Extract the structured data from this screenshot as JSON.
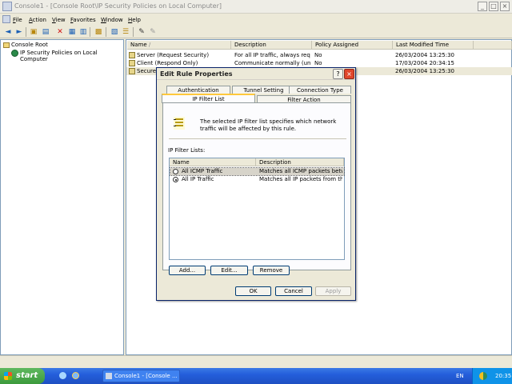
{
  "window": {
    "title": "Console1 - [Console Root\\IP Security Policies on Local Computer]"
  },
  "menu": [
    "File",
    "Action",
    "View",
    "Favorites",
    "Window",
    "Help"
  ],
  "toolbar_icons": [
    "back-icon",
    "forward-icon",
    "up-folder-icon",
    "show-hide-tree-icon",
    "delete-icon",
    "properties-icon",
    "refresh-icon",
    "export-icon",
    "help-icon",
    "manage-filters-icon",
    "assign-icon",
    "unassign-icon",
    "add-policy-icon"
  ],
  "tree": {
    "root": "Console Root",
    "child": "IP Security Policies on Local Computer"
  },
  "list": {
    "columns": [
      "Name",
      "Description",
      "Policy Assigned",
      "Last Modified Time"
    ],
    "rows": [
      {
        "name": "Server (Request Security)",
        "description": "For all IP traffic, always req...",
        "assigned": "No",
        "modified": "26/03/2004 13:25:30"
      },
      {
        "name": "Client (Respond Only)",
        "description": "Communicate normally (uns...",
        "assigned": "No",
        "modified": "17/03/2004 20:34:15"
      },
      {
        "name": "Secure S",
        "description": "",
        "assigned": "",
        "modified": "26/03/2004 13:25:30"
      }
    ]
  },
  "dialog": {
    "title": "Edit Rule Properties",
    "tabs_top": [
      "Authentication Methods",
      "Tunnel Setting",
      "Connection Type"
    ],
    "tabs_bottom": [
      "IP Filter List",
      "Filter Action"
    ],
    "info_text": "The selected IP filter list specifies which network traffic will be affected by this rule.",
    "filter_lists_label": "IP Filter Lists:",
    "filter_columns": [
      "Name",
      "Description"
    ],
    "filters": [
      {
        "name": "All ICMP Traffic",
        "description": "Matches all ICMP packets betw...",
        "selected": false
      },
      {
        "name": "All IP Traffic",
        "description": "Matches all IP packets from this ...",
        "selected": true
      }
    ],
    "buttons": {
      "add": "Add...",
      "edit": "Edit...",
      "remove": "Remove",
      "ok": "OK",
      "cancel": "Cancel",
      "apply": "Apply"
    }
  },
  "taskbar": {
    "start": "start",
    "task": "Console1 - [Console ...",
    "lang": "EN",
    "clock": "20:35"
  }
}
